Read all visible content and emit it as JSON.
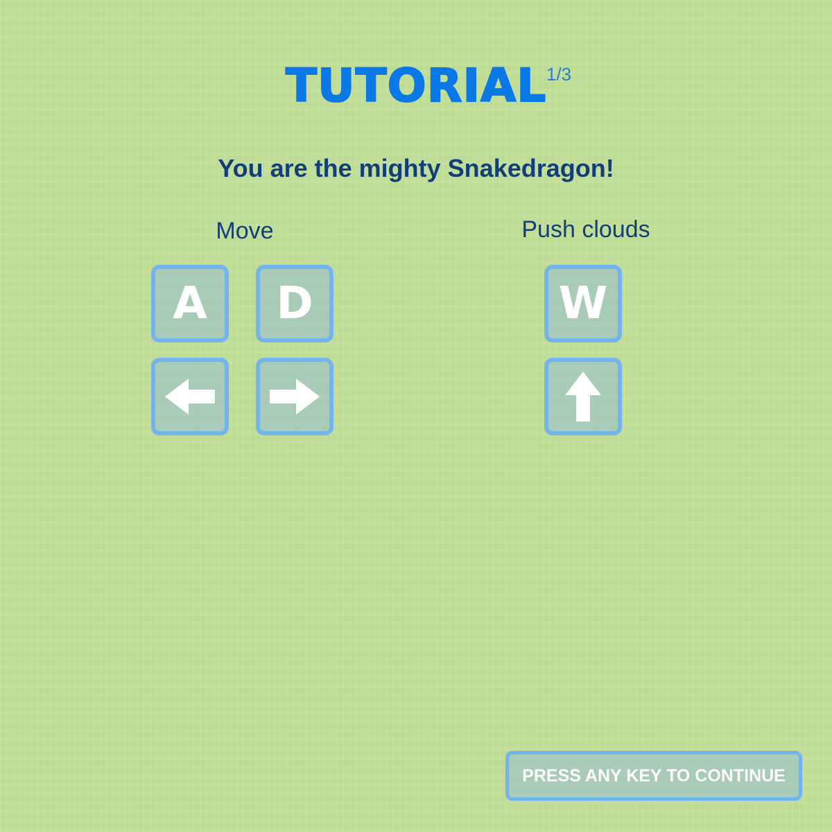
{
  "header": {
    "title": "TUTORIAL",
    "step": "1/3"
  },
  "subtitle": "You are the mighty Snakedragon!",
  "controls": {
    "move": {
      "label": "Move",
      "keys": [
        "A",
        "D"
      ],
      "arrow_icons": [
        "left-arrow-icon",
        "right-arrow-icon"
      ]
    },
    "push": {
      "label": "Push clouds",
      "keys": [
        "W"
      ],
      "arrow_icons": [
        "up-arrow-icon"
      ]
    }
  },
  "continue_label": "PRESS ANY KEY TO CONTINUE",
  "colors": {
    "background": "#bedc94",
    "title": "#0a78e6",
    "text": "#123f78",
    "key_border": "#74b4ee",
    "key_glyph": "#ffffff"
  }
}
